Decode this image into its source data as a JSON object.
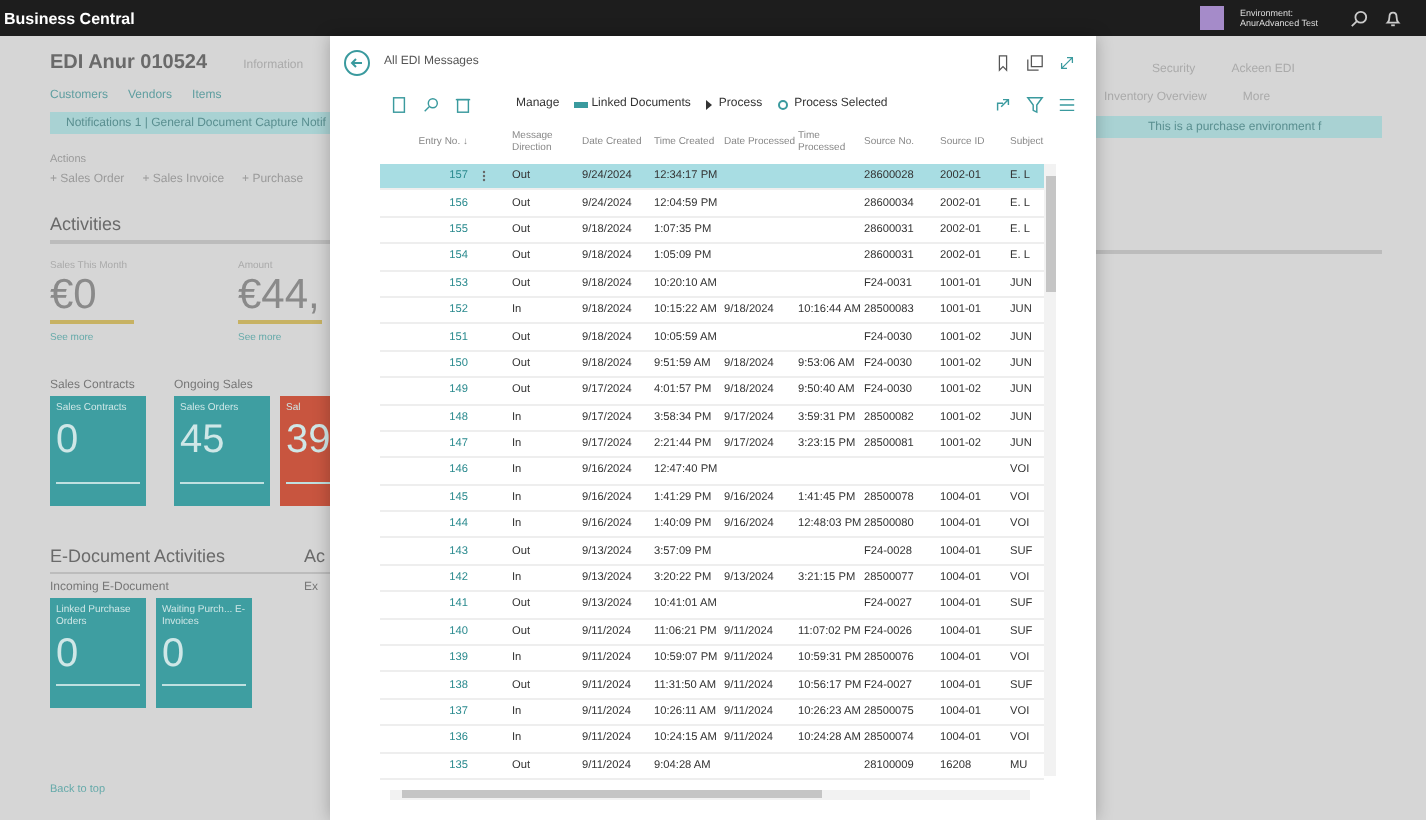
{
  "top_bar": {
    "app_name": "Business Central",
    "environment_label": "Environment:",
    "environment_name": "AnurAdvanced Test"
  },
  "page": {
    "title": "EDI Anur 010524",
    "tab": "Information",
    "nav": [
      "Customers",
      "Vendors",
      "Items"
    ],
    "notification": {
      "left": "Notifications 1  |  General Document Capture Notif",
      "right": "This is a purchase environment f"
    },
    "actions_label": "Actions",
    "actions": [
      "+ Sales Order",
      "+ Sales Invoice",
      "+ Purchase"
    ],
    "activities_title": "Activities",
    "kpis": [
      {
        "label": "Sales This Month",
        "value": "€0",
        "link": "See more"
      },
      {
        "label": "Amount",
        "value": "€44,",
        "link": "See more"
      }
    ],
    "tile_groups": [
      {
        "title": "Sales Contracts",
        "tiles": [
          {
            "title": "Sales Contracts",
            "value": "0",
            "color": "#3e9ea1"
          }
        ]
      },
      {
        "title": "Ongoing Sales",
        "tiles": [
          {
            "title": "Sales Orders",
            "value": "45",
            "color": "#3e9ea1"
          },
          {
            "title": "Sal",
            "value": "39",
            "color": "#c8553f"
          }
        ]
      }
    ],
    "edoc_title": "E-Document Activities",
    "edoc_cut_title": "Ac",
    "edoc_group": "Incoming E-Document",
    "edoc_cut_group": "Ex",
    "edoc_tiles": [
      {
        "title": "Linked Purchase Orders",
        "value": "0",
        "color": "#3e9ea1"
      },
      {
        "title": "Waiting Purch... E-Invoices",
        "value": "0",
        "color": "#3e9ea1"
      }
    ],
    "back_to_top": "Back to top",
    "right_nav": [
      "Security",
      "Ackeen EDI"
    ],
    "right_nav2": [
      "Inventory Overview",
      "More"
    ]
  },
  "dialog": {
    "title": "All EDI Messages",
    "toolbar": [
      "Manage",
      "Linked Documents",
      "Process",
      "Process Selected"
    ],
    "columns": [
      "Entry No. ↓",
      "Message Direction",
      "Date Created",
      "Time Created",
      "Date Processed",
      "Time Processed",
      "Source No.",
      "Source ID",
      "Subject"
    ],
    "rows": [
      {
        "entry_no": "157",
        "direction": "Out",
        "date_created": "9/24/2024",
        "time_created": "12:34:17 PM",
        "source_no": "28600028",
        "source_id": "2002-01",
        "subject": "E. L",
        "selected": true
      },
      {
        "entry_no": "156",
        "direction": "Out",
        "date_created": "9/24/2024",
        "time_created": "12:04:59 PM",
        "source_no": "28600034",
        "source_id": "2002-01",
        "subject": "E. L",
        "selected": false
      },
      {
        "entry_no": "155",
        "direction": "Out",
        "date_created": "9/18/2024",
        "time_created": "1:07:35 PM",
        "source_no": "28600031",
        "source_id": "2002-01",
        "subject": "E. L",
        "selected": false
      },
      {
        "entry_no": "154",
        "direction": "Out",
        "date_created": "9/18/2024",
        "time_created": "1:05:09 PM",
        "source_no": "28600031",
        "source_id": "2002-01",
        "subject": "E. L",
        "selected": false
      },
      {
        "entry_no": "153",
        "direction": "Out",
        "date_created": "9/18/2024",
        "time_created": "10:20:10 AM",
        "source_no": "F24-0031",
        "source_id": "1001-01",
        "subject": "JUN",
        "selected": false
      },
      {
        "entry_no": "152",
        "direction": "In",
        "date_created": "9/18/2024",
        "time_created": "10:15:22 AM",
        "date_processed": "9/18/2024",
        "time_processed": "10:16:44 AM",
        "source_no": "28500083",
        "source_id": "1001-01",
        "subject": "JUN",
        "selected": false
      },
      {
        "entry_no": "151",
        "direction": "Out",
        "date_created": "9/18/2024",
        "time_created": "10:05:59 AM",
        "source_no": "F24-0030",
        "source_id": "1001-02",
        "subject": "JUN",
        "selected": false
      },
      {
        "entry_no": "150",
        "direction": "Out",
        "date_created": "9/18/2024",
        "time_created": "9:51:59 AM",
        "date_processed": "9/18/2024",
        "time_processed": "9:53:06 AM",
        "source_no": "F24-0030",
        "source_id": "1001-02",
        "subject": "JUN",
        "selected": false
      },
      {
        "entry_no": "149",
        "direction": "Out",
        "date_created": "9/17/2024",
        "time_created": "4:01:57 PM",
        "date_processed": "9/18/2024",
        "time_processed": "9:50:40 AM",
        "source_no": "F24-0030",
        "source_id": "1001-02",
        "subject": "JUN",
        "selected": false
      },
      {
        "entry_no": "148",
        "direction": "In",
        "date_created": "9/17/2024",
        "time_created": "3:58:34 PM",
        "date_processed": "9/17/2024",
        "time_processed": "3:59:31 PM",
        "source_no": "28500082",
        "source_id": "1001-02",
        "subject": "JUN",
        "selected": false
      },
      {
        "entry_no": "147",
        "direction": "In",
        "date_created": "9/17/2024",
        "time_created": "2:21:44 PM",
        "date_processed": "9/17/2024",
        "time_processed": "3:23:15 PM",
        "source_no": "28500081",
        "source_id": "1001-02",
        "subject": "JUN",
        "selected": false
      },
      {
        "entry_no": "146",
        "direction": "In",
        "date_created": "9/16/2024",
        "time_created": "12:47:40 PM",
        "subject": "VOI",
        "selected": false
      },
      {
        "entry_no": "145",
        "direction": "In",
        "date_created": "9/16/2024",
        "time_created": "1:41:29 PM",
        "date_processed": "9/16/2024",
        "time_processed": "1:41:45 PM",
        "source_no": "28500078",
        "source_id": "1004-01",
        "subject": "VOI",
        "selected": false
      },
      {
        "entry_no": "144",
        "direction": "In",
        "date_created": "9/16/2024",
        "time_created": "1:40:09 PM",
        "date_processed": "9/16/2024",
        "time_processed": "12:48:03 PM",
        "source_no": "28500080",
        "source_id": "1004-01",
        "subject": "VOI",
        "selected": false
      },
      {
        "entry_no": "143",
        "direction": "Out",
        "date_created": "9/13/2024",
        "time_created": "3:57:09 PM",
        "source_no": "F24-0028",
        "source_id": "1004-01",
        "subject": "SUF",
        "selected": false
      },
      {
        "entry_no": "142",
        "direction": "In",
        "date_created": "9/13/2024",
        "time_created": "3:20:22 PM",
        "date_processed": "9/13/2024",
        "time_processed": "3:21:15 PM",
        "source_no": "28500077",
        "source_id": "1004-01",
        "subject": "VOI",
        "selected": false
      },
      {
        "entry_no": "141",
        "direction": "Out",
        "date_created": "9/13/2024",
        "time_created": "10:41:01 AM",
        "source_no": "F24-0027",
        "source_id": "1004-01",
        "subject": "SUF",
        "selected": false
      },
      {
        "entry_no": "140",
        "direction": "Out",
        "date_created": "9/11/2024",
        "time_created": "11:06:21 PM",
        "date_processed": "9/11/2024",
        "time_processed": "11:07:02 PM",
        "source_no": "F24-0026",
        "source_id": "1004-01",
        "subject": "SUF",
        "selected": false
      },
      {
        "entry_no": "139",
        "direction": "In",
        "date_created": "9/11/2024",
        "time_created": "10:59:07 PM",
        "date_processed": "9/11/2024",
        "time_processed": "10:59:31 PM",
        "source_no": "28500076",
        "source_id": "1004-01",
        "subject": "VOI",
        "selected": false
      },
      {
        "entry_no": "138",
        "direction": "Out",
        "date_created": "9/11/2024",
        "time_created": "11:31:50 AM",
        "date_processed": "9/11/2024",
        "time_processed": "10:56:17 PM",
        "source_no": "F24-0027",
        "source_id": "1004-01",
        "subject": "SUF",
        "selected": false
      },
      {
        "entry_no": "137",
        "direction": "In",
        "date_created": "9/11/2024",
        "time_created": "10:26:11 AM",
        "date_processed": "9/11/2024",
        "time_processed": "10:26:23 AM",
        "source_no": "28500075",
        "source_id": "1004-01",
        "subject": "VOI",
        "selected": false
      },
      {
        "entry_no": "136",
        "direction": "In",
        "date_created": "9/11/2024",
        "time_created": "10:24:15 AM",
        "date_processed": "9/11/2024",
        "time_processed": "10:24:28 AM",
        "source_no": "28500074",
        "source_id": "1004-01",
        "subject": "VOI",
        "selected": false
      },
      {
        "entry_no": "135",
        "direction": "Out",
        "date_created": "9/11/2024",
        "time_created": "9:04:28 AM",
        "source_no": "28100009",
        "source_id": "16208",
        "subject": "MU",
        "selected": false
      }
    ]
  }
}
